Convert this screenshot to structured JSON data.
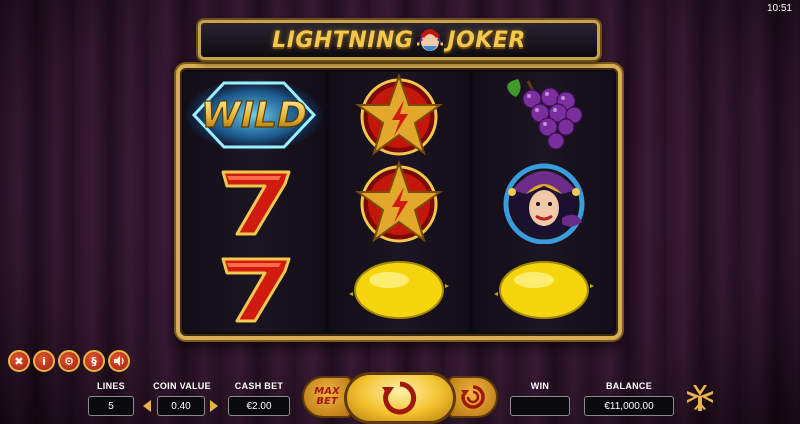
{
  "status_bar": {
    "time": "10:51"
  },
  "game": {
    "title_left": "LIGHTNING",
    "title_right": "JOKER"
  },
  "reels": [
    [
      "wild",
      "seven",
      "seven"
    ],
    [
      "star",
      "star",
      "lemon"
    ],
    [
      "grapes",
      "joker",
      "lemon"
    ]
  ],
  "wild_label": "WILD",
  "toolbar": {
    "icons": [
      "close-icon",
      "info-icon",
      "gear-icon",
      "paytable-icon",
      "sound-icon"
    ],
    "info_glyph": "i",
    "paytable_glyph": "§"
  },
  "bet_panel": {
    "lines_label": "LINES",
    "lines_value": "5",
    "coin_label": "COIN VALUE",
    "coin_value": "0.40",
    "cashbet_label": "CASH BET",
    "cashbet_value": "€2.00",
    "maxbet_label_1": "MAX",
    "maxbet_label_2": "BET",
    "win_label": "WIN",
    "win_value": "",
    "balance_label": "BALANCE",
    "balance_value": "€11,000.00"
  },
  "colors": {
    "gold": "#d7ae54",
    "red": "#c4170c",
    "lemon": "#f5d60e"
  }
}
